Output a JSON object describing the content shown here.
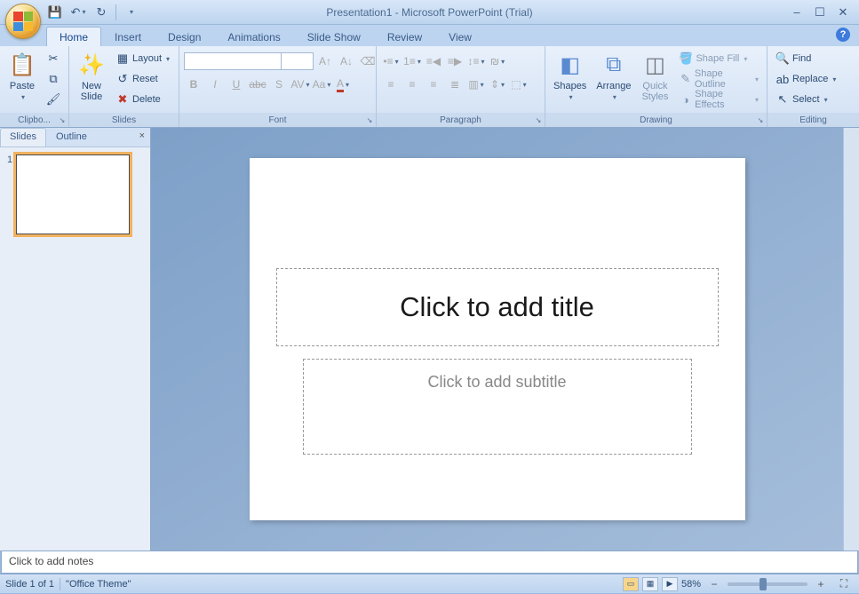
{
  "app": {
    "title": "Presentation1 - Microsoft PowerPoint (Trial)"
  },
  "qat": {
    "save": "💾",
    "undo": "↶",
    "redo": "↻"
  },
  "tabs": {
    "home": "Home",
    "insert": "Insert",
    "design": "Design",
    "animations": "Animations",
    "slideshow": "Slide Show",
    "review": "Review",
    "view": "View"
  },
  "ribbon": {
    "clipboard": {
      "label": "Clipbo...",
      "paste": "Paste"
    },
    "slides": {
      "label": "Slides",
      "new_slide": "New\nSlide",
      "layout": "Layout",
      "reset": "Reset",
      "delete": "Delete"
    },
    "font": {
      "label": "Font",
      "name_placeholder": "",
      "size_placeholder": ""
    },
    "paragraph": {
      "label": "Paragraph"
    },
    "drawing": {
      "label": "Drawing",
      "shapes": "Shapes",
      "arrange": "Arrange",
      "quick_styles": "Quick\nStyles",
      "shape_fill": "Shape Fill",
      "shape_outline": "Shape Outline",
      "shape_effects": "Shape Effects"
    },
    "editing": {
      "label": "Editing",
      "find": "Find",
      "replace": "Replace",
      "select": "Select"
    }
  },
  "side_panel": {
    "tab_slides": "Slides",
    "tab_outline": "Outline",
    "slide_number": "1"
  },
  "slide": {
    "title_placeholder": "Click to add title",
    "subtitle_placeholder": "Click to add subtitle"
  },
  "notes": {
    "placeholder": "Click to add notes"
  },
  "statusbar": {
    "slide_info": "Slide 1 of 1",
    "theme": "\"Office Theme\"",
    "zoom": "58%"
  }
}
